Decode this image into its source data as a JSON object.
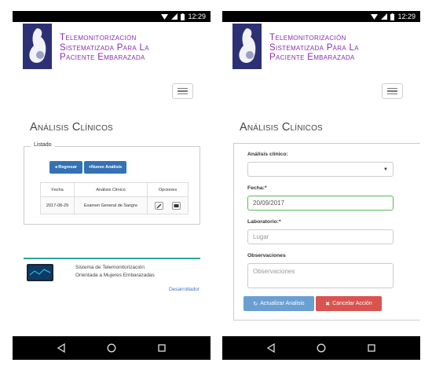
{
  "status": {
    "time": "12:29"
  },
  "header": {
    "title_line1": "Telemonitorización",
    "title_line2": "Sistematizada Para La",
    "title_line3": "Paciente Embarazada"
  },
  "page_title": "Análisis Clínicos",
  "list_screen": {
    "legend": "Listado",
    "back_button": "Regresar",
    "new_button": "Nuevo Análisis",
    "table": {
      "headers": [
        "Fecha",
        "Análisis Clínico",
        "Opciones"
      ],
      "rows": [
        {
          "fecha": "2017-08-29",
          "analisis": "Examen General de Sangre"
        }
      ]
    },
    "footer": {
      "line1": "Sistema de Telemonitorización",
      "line2": "Orientada a Mujeres Embarazadas",
      "developer_link": "Desarrollador"
    }
  },
  "form_screen": {
    "analisis_label": "Análisis clínico:",
    "analisis_value": "",
    "fecha_label": "Fecha:*",
    "fecha_value": "20/09/2017",
    "laboratorio_label": "Laboratorio:*",
    "laboratorio_placeholder": "Lugar",
    "observaciones_label": "Observaciones",
    "observaciones_placeholder": "Observaciones",
    "update_button": "Actualizar Analisis",
    "cancel_button": "Cancelar Acción"
  },
  "colors": {
    "title": "#8a2fb5",
    "primary_button": "#3471b5",
    "update_button": "#6a9fd3",
    "cancel_button": "#d9534f",
    "footer_line": "#2aa59e"
  }
}
